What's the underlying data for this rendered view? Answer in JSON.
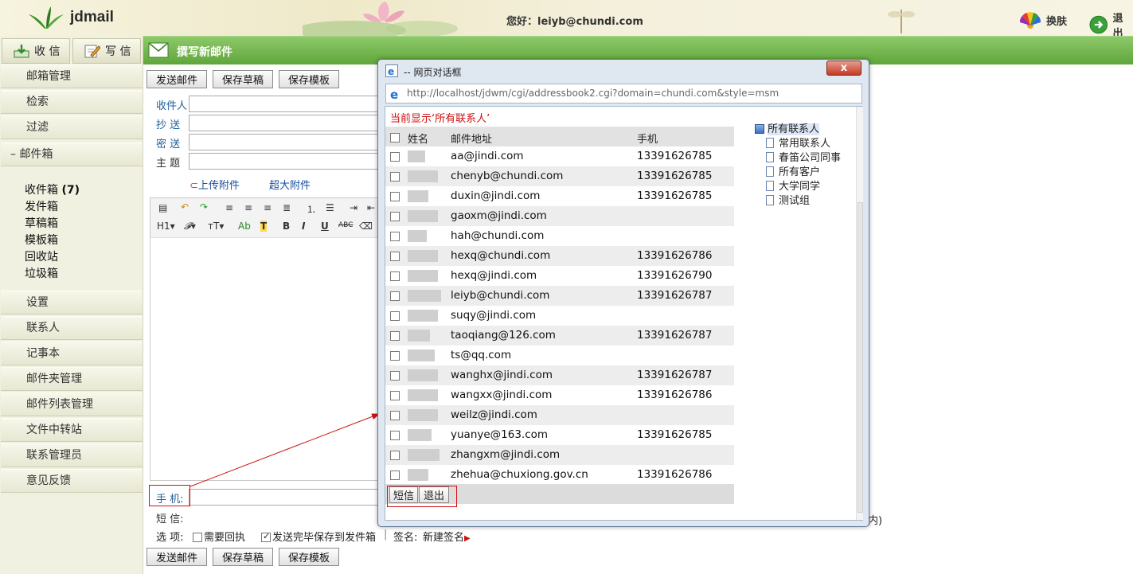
{
  "header": {
    "logo": "jdmail",
    "greeting": "您好：leiyb@chundi.com",
    "skin_label": "换肤",
    "logout_label": "退出"
  },
  "topnav": {
    "receive_label": "收 信",
    "write_label": "写 信",
    "compose_title": "撰写新邮件"
  },
  "sidebar": {
    "items_top": [
      "邮箱管理",
      "检索",
      "过滤"
    ],
    "mailbox_section": "– 邮件箱",
    "folders": [
      "收件箱",
      "发件箱",
      "草稿箱",
      "模板箱",
      "回收站",
      "垃圾箱"
    ],
    "inbox_count": "(7)",
    "items_bottom": [
      "设置",
      "联系人",
      "记事本",
      "邮件夹管理",
      "邮件列表管理",
      "文件中转站",
      "联系管理员",
      "意见反馈"
    ]
  },
  "compose": {
    "send_label": "发送邮件",
    "save_draft_label": "保存草稿",
    "save_template_label": "保存模板",
    "to_label": "收件人",
    "cc_label": "抄 送",
    "bcc_label": "密 送",
    "subject_label": "主 题",
    "upload_label": "上传附件",
    "big_attach_label": "超大附件",
    "mobile_label": "手 机:",
    "sms_label": "短 信:",
    "options_label": "选 项:",
    "need_receipt_label": "需要回执",
    "save_sent_label": "发送完毕保存到发件箱",
    "signature_label": "签名:",
    "new_signature_label": "新建签名",
    "trailing_text": "内)"
  },
  "dialog": {
    "title": "-- 网页对话框",
    "close_label": "x",
    "url": "http://localhost/jdwm/cgi/addressbook2.cgi?domain=chundi.com&style=msm",
    "showing_text": "当前显示‘所有联系人’",
    "columns": {
      "name": "姓名",
      "email": "邮件地址",
      "phone": "手机"
    },
    "contacts": [
      {
        "email": "aa@jindi.com",
        "phone": "13391626785"
      },
      {
        "email": "chenyb@chundi.com",
        "phone": "13391626785"
      },
      {
        "email": "duxin@jindi.com",
        "phone": "13391626785"
      },
      {
        "email": "gaoxm@jindi.com",
        "phone": ""
      },
      {
        "email": "hah@chundi.com",
        "phone": ""
      },
      {
        "email": "hexq@chundi.com",
        "phone": "13391626786"
      },
      {
        "email": "hexq@jindi.com",
        "phone": "13391626790"
      },
      {
        "email": "leiyb@chundi.com",
        "phone": "13391626787"
      },
      {
        "email": "suqy@jindi.com",
        "phone": ""
      },
      {
        "email": "taoqiang@126.com",
        "phone": "13391626787"
      },
      {
        "email": "ts@qq.com",
        "phone": ""
      },
      {
        "email": "wanghx@jindi.com",
        "phone": "13391626787"
      },
      {
        "email": "wangxx@jindi.com",
        "phone": "13391626786"
      },
      {
        "email": "weilz@jindi.com",
        "phone": ""
      },
      {
        "email": "yuanye@163.com",
        "phone": "13391626785"
      },
      {
        "email": "zhangxm@jindi.com",
        "phone": ""
      },
      {
        "email": "zhehua@chuxiong.gov.cn",
        "phone": "13391626786"
      }
    ],
    "sms_button": "短信",
    "exit_button": "退出",
    "tree_root": "所有联系人",
    "tree_groups": [
      "常用联系人",
      "春笛公司同事",
      "所有客户",
      "大学同学",
      "测试组"
    ]
  },
  "colors": {
    "accent_green": "#5fa63b",
    "highlight_red": "#d01010",
    "link_blue": "#1b4fa0"
  }
}
